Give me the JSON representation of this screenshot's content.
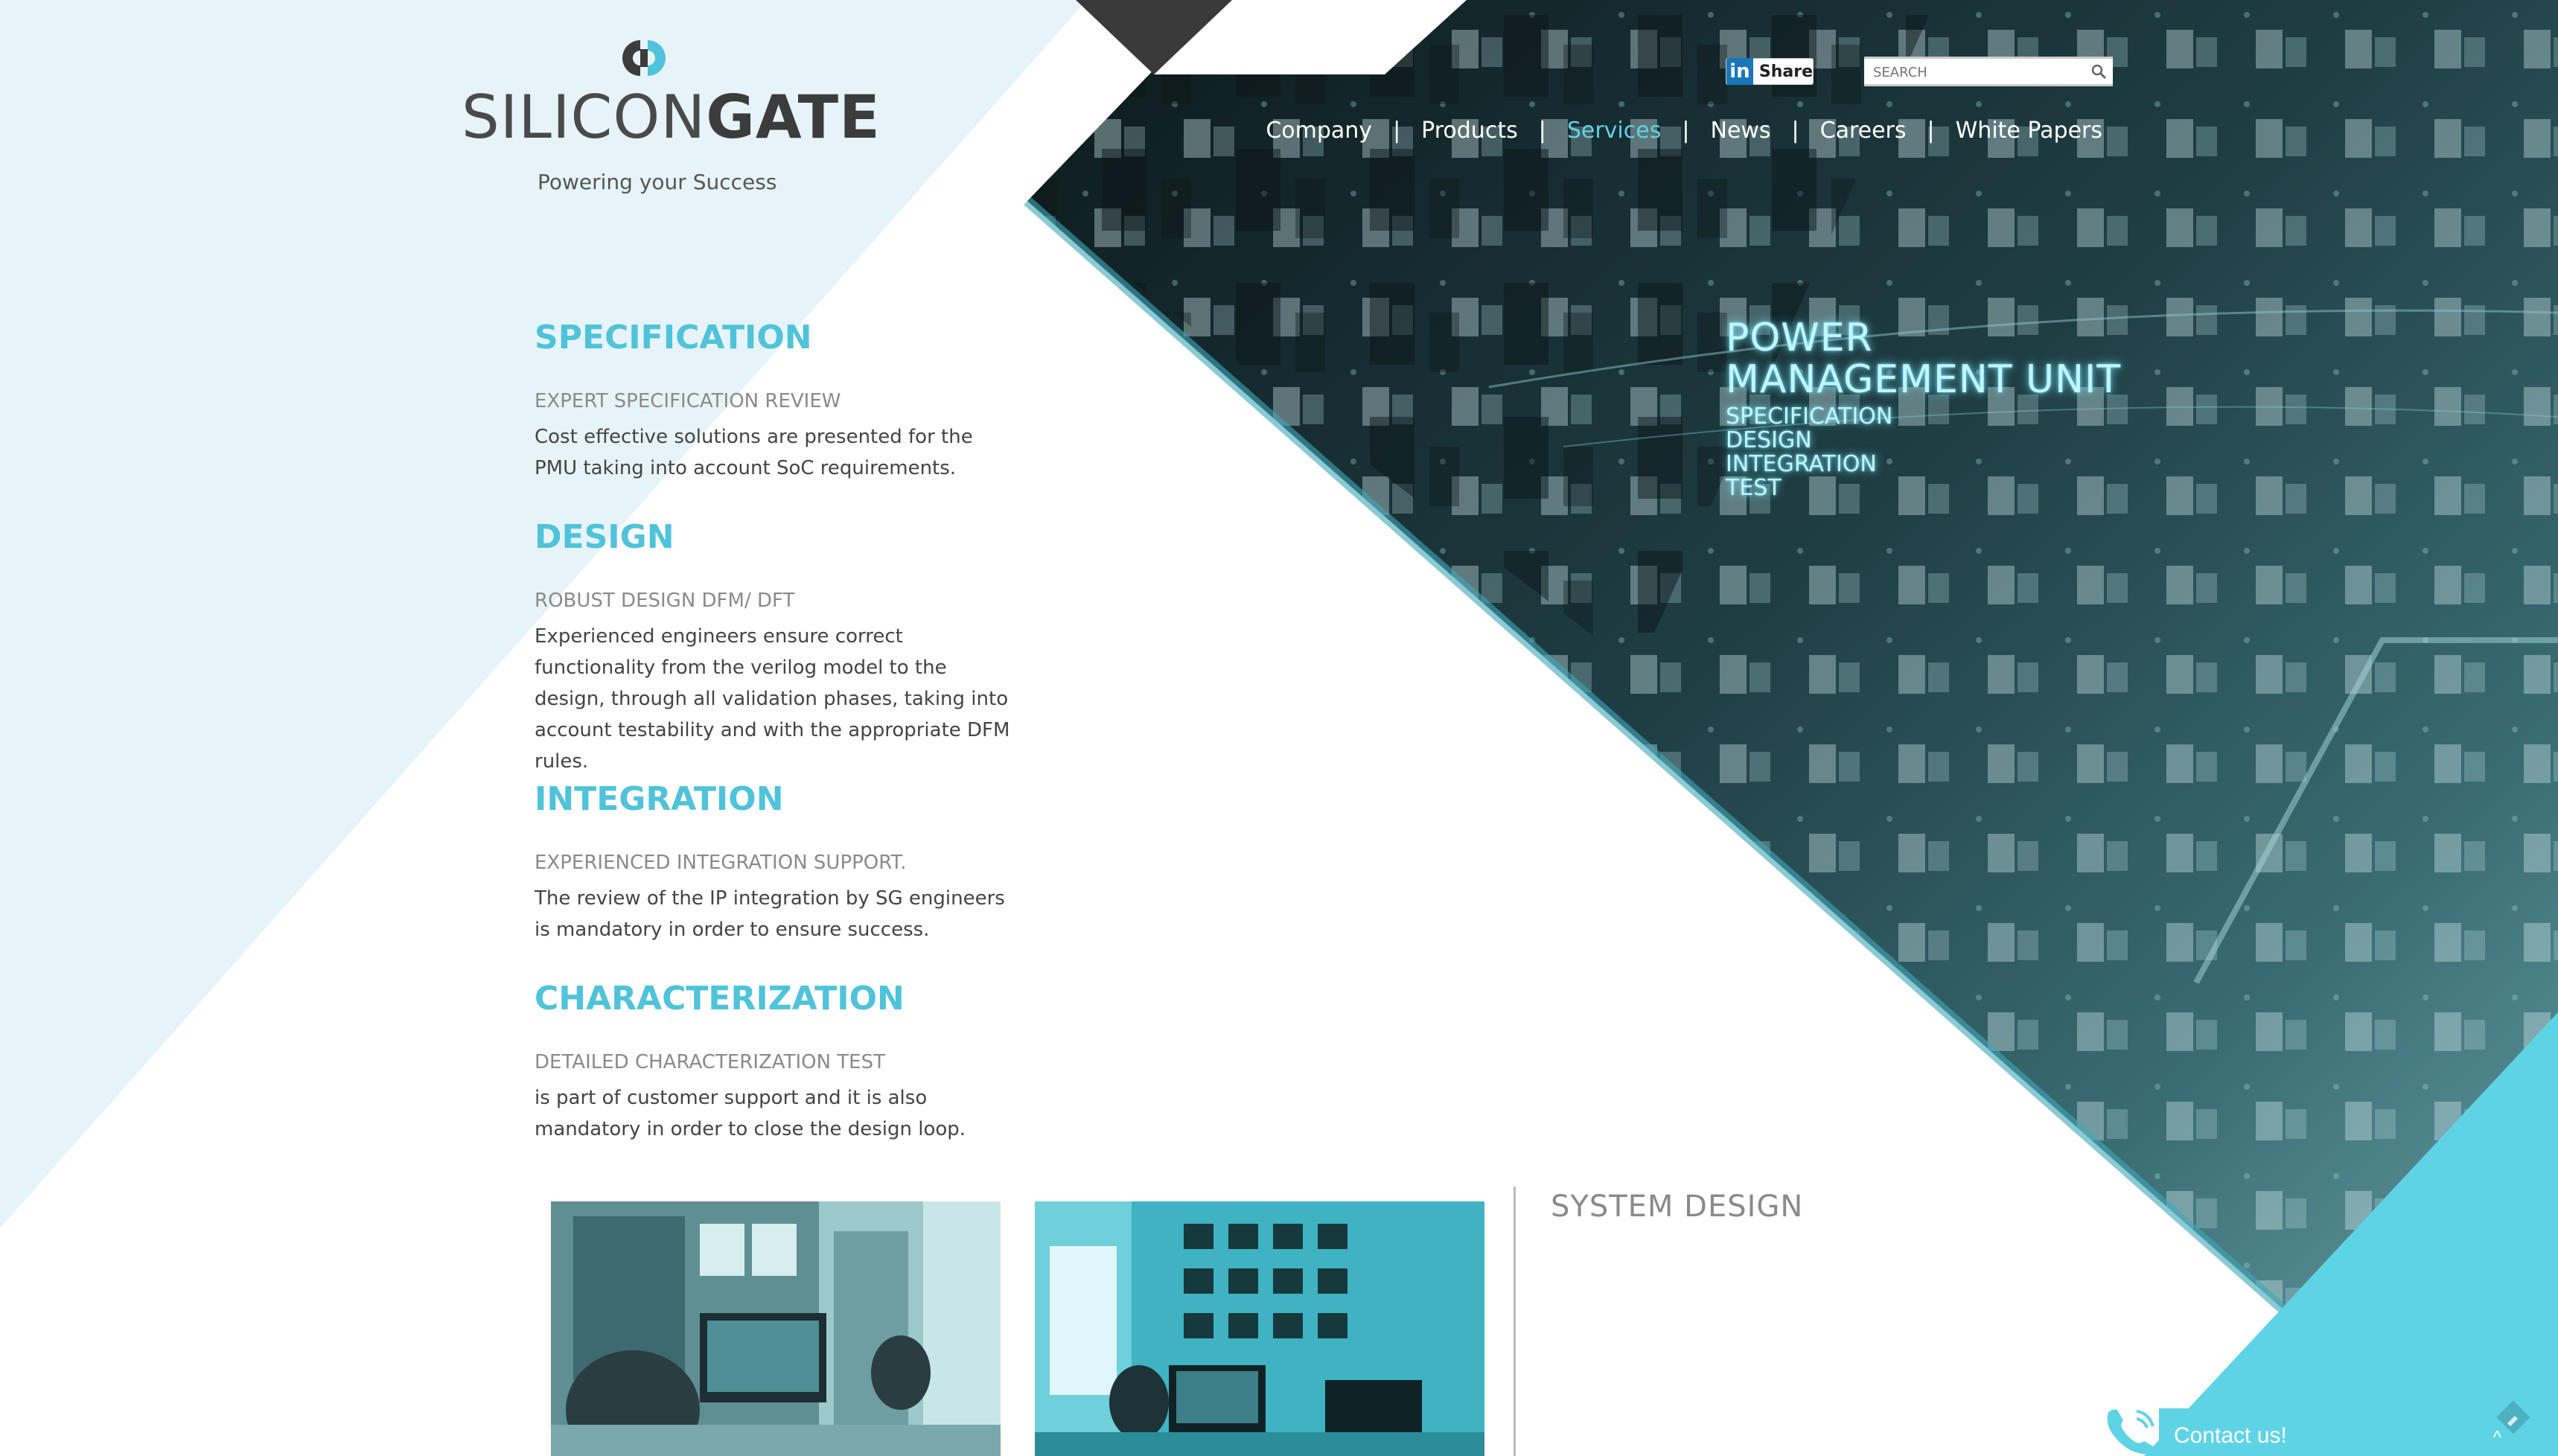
{
  "brand": {
    "logo_text_a": "SILICON",
    "logo_text_b": "GATE",
    "tagline": "Powering your Success"
  },
  "toolbar": {
    "share_icon_text": "in",
    "share_label": "Share",
    "search_placeholder": "SEARCH"
  },
  "nav": {
    "items": [
      {
        "label": "Company"
      },
      {
        "label": "Products"
      },
      {
        "label": "Services"
      },
      {
        "label": "News"
      },
      {
        "label": "Careers"
      },
      {
        "label": "White Papers"
      }
    ],
    "separator": "|",
    "active": "Services"
  },
  "hero": {
    "title_line1": "POWER",
    "title_line2": "MANAGEMENT UNIT",
    "sub": [
      "SPECIFICATION",
      "DESIGN",
      "INTEGRATION",
      "TEST"
    ]
  },
  "sections": [
    {
      "title": "SPECIFICATION",
      "subtitle": "EXPERT SPECIFICATION REVIEW",
      "body": "Cost effective solutions are presented for the PMU taking into account SoC requirements."
    },
    {
      "title": "DESIGN",
      "subtitle": "ROBUST DESIGN DFM/ DFT",
      "body": "Experienced engineers ensure correct functionality from the verilog model to the design, through all validation phases, taking into account testability and with the appropriate DFM rules."
    },
    {
      "title": "INTEGRATION",
      "subtitle": "EXPERIENCED INTEGRATION SUPPORT.",
      "body": "The review of the IP integration by SG engineers is mandatory in order to ensure success."
    },
    {
      "title": "CHARACTERIZATION",
      "subtitle": "DETAILED CHARACTERIZATION TEST",
      "body": "is part of customer support and it is also mandatory in order to close the design loop."
    }
  ],
  "system_design": {
    "title": "SYSTEM DESIGN"
  },
  "contact": {
    "label": "Contact us!",
    "chevron": "^"
  },
  "colors": {
    "accent": "#4fc3d9",
    "light_bg": "#e6f4f9",
    "dark_photo": "#1e3b40",
    "cyan_corner": "#5fd3e6"
  },
  "icons": {
    "share": "linkedin-icon",
    "search": "magnifier-icon",
    "contact": "phone-icon",
    "pin": "pin-icon"
  }
}
